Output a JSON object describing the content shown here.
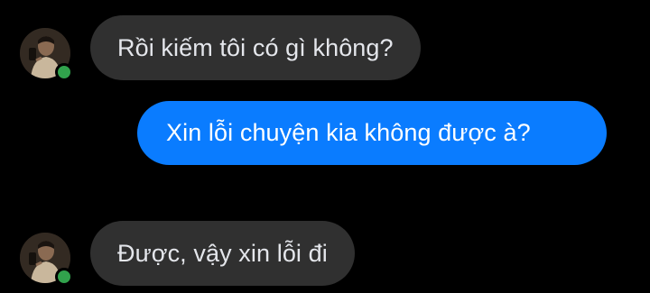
{
  "contact": {
    "avatar_icon": "user-avatar-photo",
    "status": "online",
    "status_color": "#31a24c"
  },
  "messages": [
    {
      "direction": "incoming",
      "text": "Rồi kiếm tôi có gì không?"
    },
    {
      "direction": "outgoing",
      "text": "Xin lỗi chuyện kia không được à?"
    },
    {
      "direction": "incoming",
      "text": "Được, vậy xin lỗi đi"
    }
  ],
  "colors": {
    "background": "#000000",
    "incoming_bubble": "#303030",
    "outgoing_bubble": "#0a7cff",
    "incoming_text": "#e4e6eb",
    "outgoing_text": "#ffffff"
  }
}
